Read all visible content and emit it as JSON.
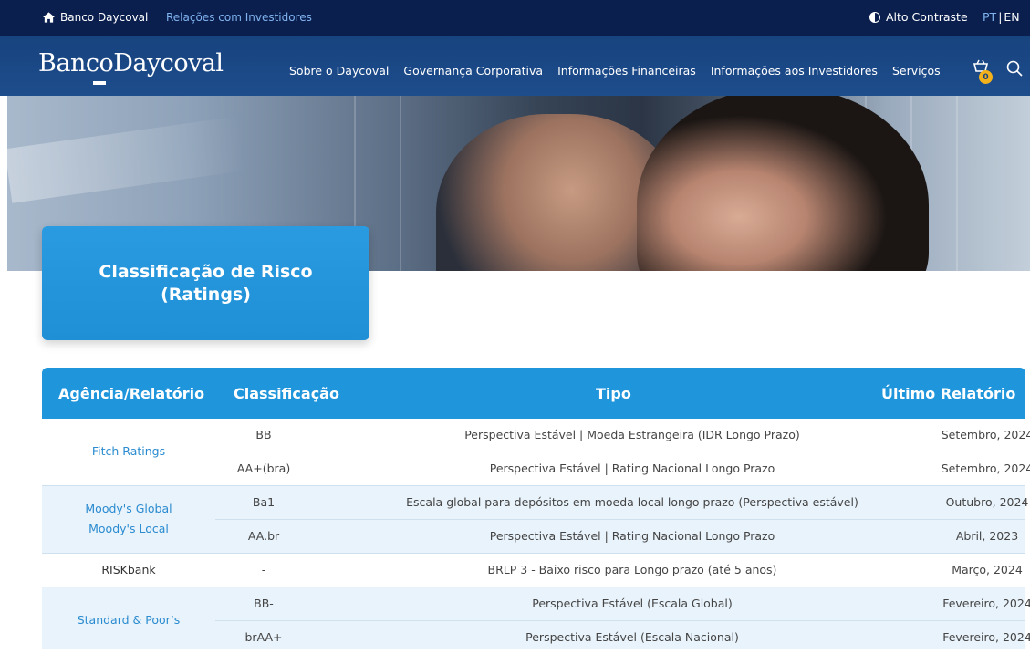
{
  "topbar": {
    "home_label": "Banco Daycoval",
    "ri_label": "Relações com Investidores",
    "contrast_label": "Alto Contraste",
    "lang_pt": "PT",
    "lang_sep": "|",
    "lang_en": "EN"
  },
  "nav": {
    "logo_text": "BancoDaycoval",
    "menu": [
      "Sobre o Daycoval",
      "Governança Corporativa",
      "Informações Financeiras",
      "Informações aos Investidores",
      "Serviços"
    ],
    "cart_count": "0",
    "icons": {
      "cart": "cart-icon",
      "search": "search-icon",
      "home": "home-icon",
      "contrast": "contrast-icon"
    }
  },
  "title": {
    "line1": "Classificação de Risco",
    "line2": "(Ratings)"
  },
  "table": {
    "headers": [
      "Agência/Relatório",
      "Classificação",
      "Tipo",
      "Último Relatório"
    ],
    "groups": [
      {
        "agency": [
          "Fitch Ratings"
        ],
        "rows": [
          [
            "BB",
            "Perspectiva Estável | Moeda Estrangeira (IDR Longo Prazo)",
            "Setembro, 2024"
          ],
          [
            "AA+(bra)",
            "Perspectiva Estável | Rating Nacional Longo Prazo",
            "Setembro, 2024"
          ]
        ]
      },
      {
        "agency": [
          "Moody's Global",
          "Moody's Local"
        ],
        "rows": [
          [
            "Ba1",
            "Escala global para depósitos em moeda local longo prazo (Perspectiva estável)",
            "Outubro, 2024"
          ],
          [
            "AA.br",
            "Perspectiva Estável | Rating Nacional Longo Prazo",
            "Abril, 2023"
          ]
        ]
      },
      {
        "agency": [
          "RISKbank"
        ],
        "rows": [
          [
            "-",
            "BRLP 3 - Baixo risco para Longo prazo (até 5 anos)",
            "Março, 2024"
          ]
        ]
      },
      {
        "agency": [
          "Standard & Poor’s"
        ],
        "rows": [
          [
            "BB-",
            "Perspectiva Estável (Escala Global)",
            "Fevereiro, 2024"
          ],
          [
            "brAA+",
            "Perspectiva Estável (Escala Nacional)",
            "Fevereiro, 2024"
          ]
        ]
      }
    ]
  },
  "colors": {
    "topbar": "#0b1f4f",
    "nav": "#1e4d8c",
    "accent": "#1f95dc",
    "link": "#2a8bd0",
    "badge": "#f3b21b"
  }
}
